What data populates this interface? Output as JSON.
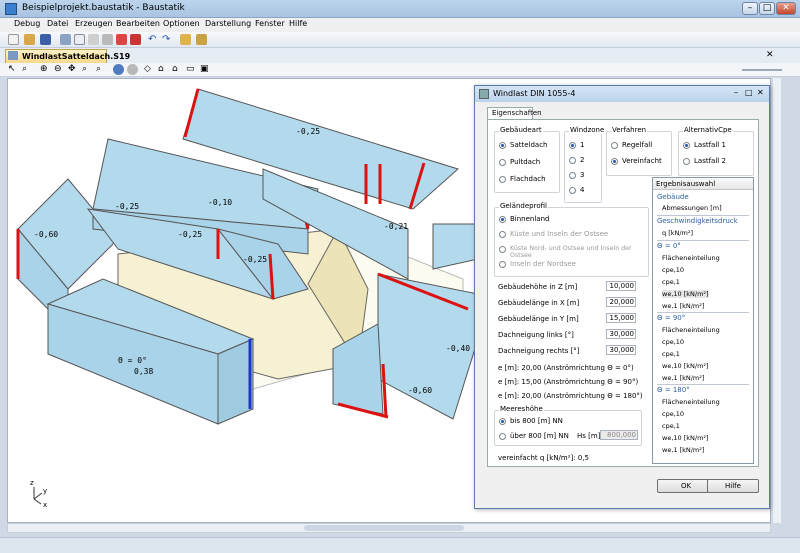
{
  "window": {
    "title": "Beispielprojekt.baustatik - Baustatik"
  },
  "menu": [
    "Debug",
    "Datei",
    "Erzeugen",
    "Bearbeiten",
    "Optionen",
    "Darstellung",
    "Fenster",
    "Hilfe"
  ],
  "document_tab": "WindlastSatteldach.S19",
  "model_labels": [
    "-0,25",
    "-0,25",
    "-0,10",
    "-0,60",
    "-0,25",
    "-0,25",
    "-0,21",
    "-0,40",
    "-0,60",
    "Θ = 0°",
    "0,38"
  ],
  "axis_labels": {
    "z": "z",
    "y": "y",
    "x": "x"
  },
  "dialog": {
    "title": "Windlast DIN 1055-4",
    "tab": "Eigenschaften",
    "gebaeudeart": {
      "title": "Gebäudeart",
      "options": [
        "Satteldach",
        "Pultdach",
        "Flachdach"
      ],
      "selected": 0
    },
    "windzone": {
      "title": "Windzone",
      "options": [
        "1",
        "2",
        "3",
        "4"
      ],
      "selected": 0
    },
    "verfahren": {
      "title": "Verfahren",
      "options": [
        "Regelfall",
        "Vereinfacht"
      ],
      "selected": 1
    },
    "alternativ": {
      "title": "AlternativCpe",
      "options": [
        "Lastfall 1",
        "Lastfall 2"
      ],
      "selected": 0
    },
    "gelaende": {
      "title": "Geländeprofil",
      "options": [
        "Binnenland",
        "Küste und Inseln der Ostsee",
        "Küste Nord- und Ostsee und Inseln der Ostsee",
        "Inseln der Nordsee"
      ],
      "selected": 0
    },
    "fields": [
      {
        "label": "Gebäudehöhe in Z [m]",
        "value": "10,000"
      },
      {
        "label": "Gebäudelänge in X [m]",
        "value": "20,000"
      },
      {
        "label": "Gebäudelänge in Y [m]",
        "value": "15,000"
      },
      {
        "label": "Dachneigung links [°]",
        "value": "30,000"
      },
      {
        "label": "Dachneigung rechts [°]",
        "value": "30,000"
      }
    ],
    "e_lines": [
      "e [m]: 20,00  (Anströmrichtung Θ = 0°)",
      "e [m]: 15,00  (Anströmrichtung Θ = 90°)",
      "e [m]: 20,00  (Anströmrichtung Θ = 180°)"
    ],
    "meereshoehe": {
      "title": "Meereshöhe",
      "options": [
        "bis 800 [m] NN",
        "über 800 [m] NN"
      ],
      "selected": 0,
      "hs_label": "Hs [m]",
      "hs_value": "800,000"
    },
    "q_line": "vereinfacht q [kN/m²]: 0,5",
    "ok": "OK",
    "help": "Hilfe",
    "result": {
      "title": "Ergebnisauswahl",
      "sections": [
        {
          "head": "Gebäude",
          "items": [
            "Abmessungen [m]"
          ]
        },
        {
          "head": "Geschwindigkeitsdruck",
          "items": [
            "q [kN/m²]"
          ]
        },
        {
          "head": "Θ = 0°",
          "items": [
            "Flächeneinteilung",
            "cpe,10",
            "cpe,1",
            "we,10 [kN/m²]",
            "we,1 [kN/m²]"
          ]
        },
        {
          "head": "Θ = 90°",
          "items": [
            "Flächeneinteilung",
            "cpe,10",
            "cpe,1",
            "we,10 [kN/m²]",
            "we,1 [kN/m²]"
          ]
        },
        {
          "head": "Θ = 180°",
          "items": [
            "Flächeneinteilung",
            "cpe,10",
            "cpe,1",
            "we,10 [kN/m²]",
            "we,1 [kN/m²]"
          ]
        }
      ]
    }
  }
}
